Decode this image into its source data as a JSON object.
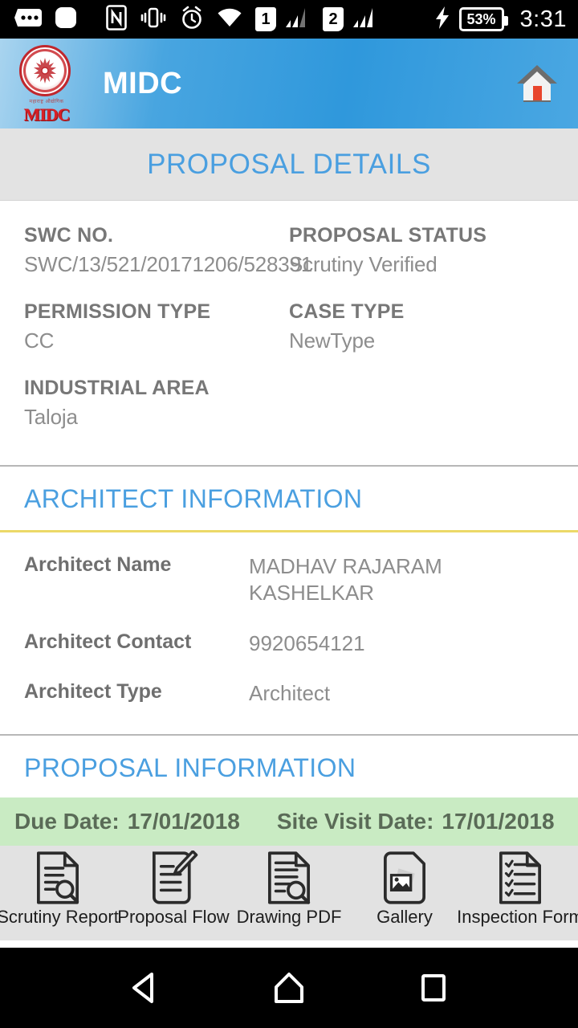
{
  "statusbar": {
    "time": "3:31",
    "battery_percent": "53%",
    "sim1_label": "1",
    "sim2_label": "2",
    "icons": [
      "dots-icon",
      "rounded-square-icon",
      "nfc-icon",
      "vibrate-icon",
      "alarm-icon",
      "wifi-icon",
      "sim1-icon",
      "signal-icon",
      "sim2-icon",
      "signal-icon",
      "charging-bolt-icon",
      "battery-icon"
    ]
  },
  "appbar": {
    "title": "MIDC",
    "logo_text": "MIDC",
    "logo_subtext": "महाराष्ट्र औद्योगिक",
    "home_icon": "home-icon"
  },
  "page": {
    "title": "PROPOSAL DETAILS"
  },
  "details": [
    {
      "label": "SWC NO.",
      "value": "SWC/13/521/20171206/528391"
    },
    {
      "label": "PROPOSAL STATUS",
      "value": "Scrutiny Verified"
    },
    {
      "label": "PERMISSION TYPE",
      "value": "CC"
    },
    {
      "label": "CASE TYPE",
      "value": "NewType"
    },
    {
      "label": "INDUSTRIAL AREA",
      "value": "Taloja"
    }
  ],
  "architect": {
    "heading": "ARCHITECT INFORMATION",
    "rows": [
      {
        "key": "Architect Name",
        "value": "MADHAV RAJARAM KASHELKAR"
      },
      {
        "key": "Architect Contact",
        "value": "9920654121"
      },
      {
        "key": "Architect Type",
        "value": "Architect"
      }
    ]
  },
  "proposal": {
    "heading": "PROPOSAL INFORMATION",
    "due_date_label": "Due Date:",
    "due_date_value": "17/01/2018",
    "site_visit_label": "Site Visit Date:",
    "site_visit_value": "17/01/2018"
  },
  "toolbar": {
    "items": [
      {
        "label": "Scrutiny Report",
        "icon": "document-search-icon"
      },
      {
        "label": "Proposal Flow",
        "icon": "document-edit-icon"
      },
      {
        "label": "Drawing PDF",
        "icon": "document-search-icon"
      },
      {
        "label": "Gallery",
        "icon": "document-image-icon"
      },
      {
        "label": "Inspection Form",
        "icon": "document-checklist-icon"
      }
    ]
  },
  "navbar": {
    "back": "back-icon",
    "home": "home-icon",
    "recents": "recents-icon"
  },
  "colors": {
    "accent_blue": "#4a9fe0",
    "appbar_blue": "#2f98dc",
    "yellow_rule": "#ecd968",
    "green_bar": "#c9ebc3",
    "label_gray": "#777777",
    "value_gray": "#8d8d8d"
  }
}
